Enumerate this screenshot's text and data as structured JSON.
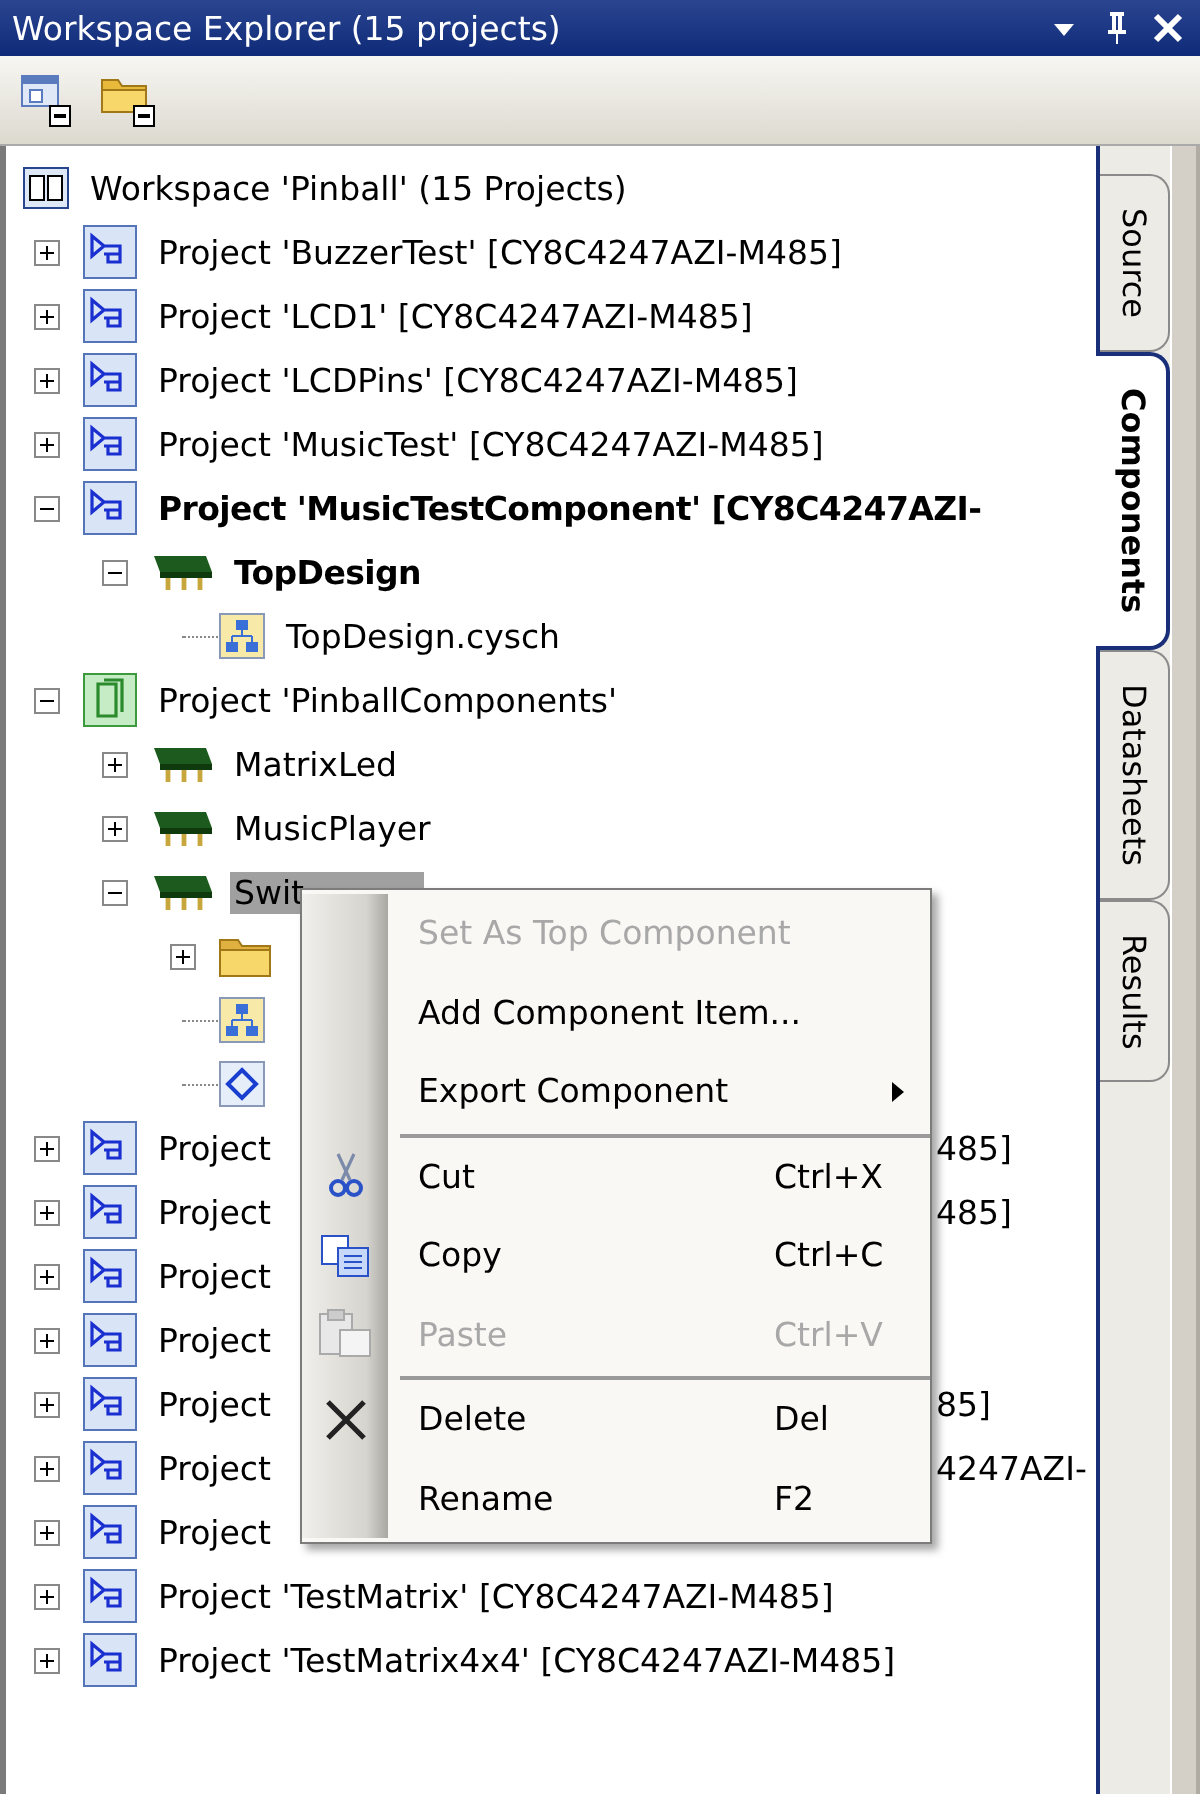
{
  "panel": {
    "title": "Workspace Explorer (15 projects)"
  },
  "tree": {
    "kind": "workspace",
    "label": "Workspace 'Pinball' (15 Projects)",
    "selected": false,
    "active": false,
    "children": [
      {
        "kind": "project",
        "label": "Project  'BuzzerTest' [CY8C4247AZI-M485]",
        "expanded": false,
        "selected": false,
        "active": false
      },
      {
        "kind": "project",
        "label": "Project  'LCD1' [CY8C4247AZI-M485]",
        "expanded": false,
        "selected": false,
        "active": false
      },
      {
        "kind": "project",
        "label": "Project  'LCDPins' [CY8C4247AZI-M485]",
        "expanded": false,
        "selected": false,
        "active": false
      },
      {
        "kind": "project",
        "label": "Project  'MusicTest' [CY8C4247AZI-M485]",
        "expanded": false,
        "selected": false,
        "active": false
      },
      {
        "kind": "project",
        "label": "Project  'MusicTestComponent' [CY8C4247AZI-",
        "expanded": true,
        "selected": false,
        "active": true,
        "children": [
          {
            "kind": "component",
            "label": "TopDesign",
            "expanded": true,
            "selected": false,
            "active": true,
            "children": [
              {
                "kind": "schematic",
                "label": "TopDesign.cysch",
                "selected": false,
                "active": false
              }
            ]
          }
        ]
      },
      {
        "kind": "library",
        "label": "Project  'PinballComponents'",
        "expanded": true,
        "selected": false,
        "active": false,
        "children": [
          {
            "kind": "component",
            "label": "MatrixLed",
            "expanded": false,
            "selected": false,
            "active": false
          },
          {
            "kind": "component",
            "label": "MusicPlayer",
            "expanded": false,
            "selected": false,
            "active": false
          },
          {
            "kind": "component",
            "label": "Swit",
            "expanded": true,
            "selected": true,
            "active": false,
            "children": [
              {
                "kind": "folder",
                "expanded": false
              },
              {
                "kind": "schematic"
              },
              {
                "kind": "symbol"
              }
            ]
          }
        ]
      },
      {
        "kind": "project",
        "label": "Project",
        "tail": "485]",
        "expanded": false,
        "selected": false,
        "active": false
      },
      {
        "kind": "project",
        "label": "Project",
        "tail": "485]",
        "expanded": false,
        "selected": false,
        "active": false
      },
      {
        "kind": "project",
        "label": "Project",
        "expanded": false,
        "selected": false,
        "active": false
      },
      {
        "kind": "project",
        "label": "Project",
        "expanded": false,
        "selected": false,
        "active": false
      },
      {
        "kind": "project",
        "label": "Project",
        "tail": "85]",
        "expanded": false,
        "selected": false,
        "active": false
      },
      {
        "kind": "project",
        "label": "Project",
        "tail": "4247AZI-",
        "expanded": false,
        "selected": false,
        "active": false
      },
      {
        "kind": "project",
        "label": "Project",
        "expanded": false,
        "selected": false,
        "active": false
      },
      {
        "kind": "project",
        "label": "Project  'TestMatrix' [CY8C4247AZI-M485]",
        "expanded": false,
        "selected": false,
        "active": false
      },
      {
        "kind": "project",
        "label": "Project  'TestMatrix4x4' [CY8C4247AZI-M485]",
        "expanded": false,
        "selected": false,
        "active": false
      }
    ]
  },
  "tabs": [
    {
      "label": "Source",
      "selected": false
    },
    {
      "label": "Components",
      "selected": true
    },
    {
      "label": "Datasheets",
      "selected": false
    },
    {
      "label": "Results",
      "selected": false
    }
  ],
  "context_menu": [
    {
      "kind": "plain",
      "label": "Set As Top Component",
      "disabled": true,
      "submenu": false
    },
    {
      "kind": "plain",
      "label": "Add Component Item...",
      "disabled": false,
      "submenu": false
    },
    {
      "kind": "plain",
      "label": "Export Component",
      "disabled": false,
      "submenu": true
    },
    {
      "kind": "separator"
    },
    {
      "kind": "cut",
      "label": "Cut",
      "shortcut": "Ctrl+X",
      "disabled": false,
      "submenu": false
    },
    {
      "kind": "copy",
      "label": "Copy",
      "shortcut": "Ctrl+C",
      "disabled": false,
      "submenu": false
    },
    {
      "kind": "paste",
      "label": "Paste",
      "shortcut": "Ctrl+V",
      "disabled": true,
      "submenu": false
    },
    {
      "kind": "separator"
    },
    {
      "kind": "delete",
      "label": "Delete",
      "shortcut": "Del",
      "disabled": false,
      "submenu": false
    },
    {
      "kind": "plain",
      "label": "Rename",
      "shortcut": "F2",
      "disabled": false,
      "submenu": false
    }
  ]
}
